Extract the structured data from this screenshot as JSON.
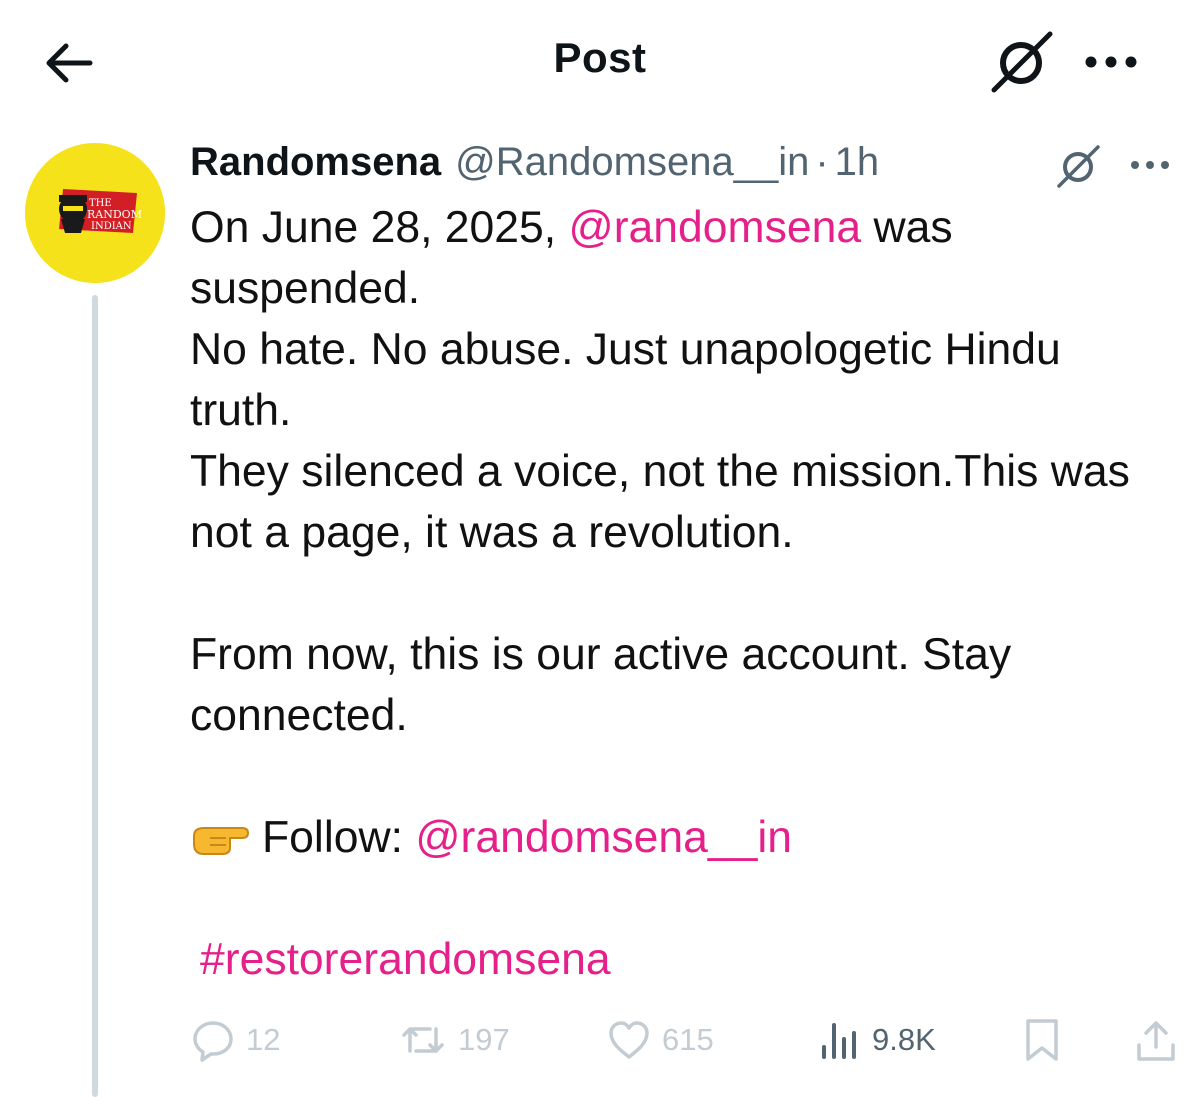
{
  "header": {
    "title": "Post",
    "back_icon": "arrow-left-icon",
    "grok_icon": "grok-icon",
    "more_icon": "more-horizontal-icon"
  },
  "post": {
    "display_name": "Randomsena",
    "handle": "@Randomsena__in",
    "separator": "·",
    "time": "1h",
    "avatar": {
      "label_line1": "THE",
      "label_line2": "RANDOM",
      "label_line3": "INDIAN",
      "background": "#f6e21a"
    },
    "body": {
      "line1_pre": "On June 28, 2025, ",
      "line1_mention": "@randomsena",
      "line1_post": " was suspended.",
      "line2": "No hate. No abuse. Just unapologetic Hindu truth.",
      "line3": "They silenced a voice, not the mission.This was not a page, it was a revolution.",
      "line4": "From now, this is our active account. Stay connected.",
      "follow_label": "Follow: ",
      "follow_mention": "@randomsena__in",
      "hashtag": "#restorerandomsena"
    },
    "actions": {
      "replies": "12",
      "reposts": "197",
      "likes": "615",
      "views": "9.8K"
    }
  },
  "colors": {
    "link": "#e5208a",
    "text": "#0f1419",
    "secondary": "#536471",
    "muted_actions": "#c3ccd2",
    "thread_line": "#cfd9de"
  }
}
